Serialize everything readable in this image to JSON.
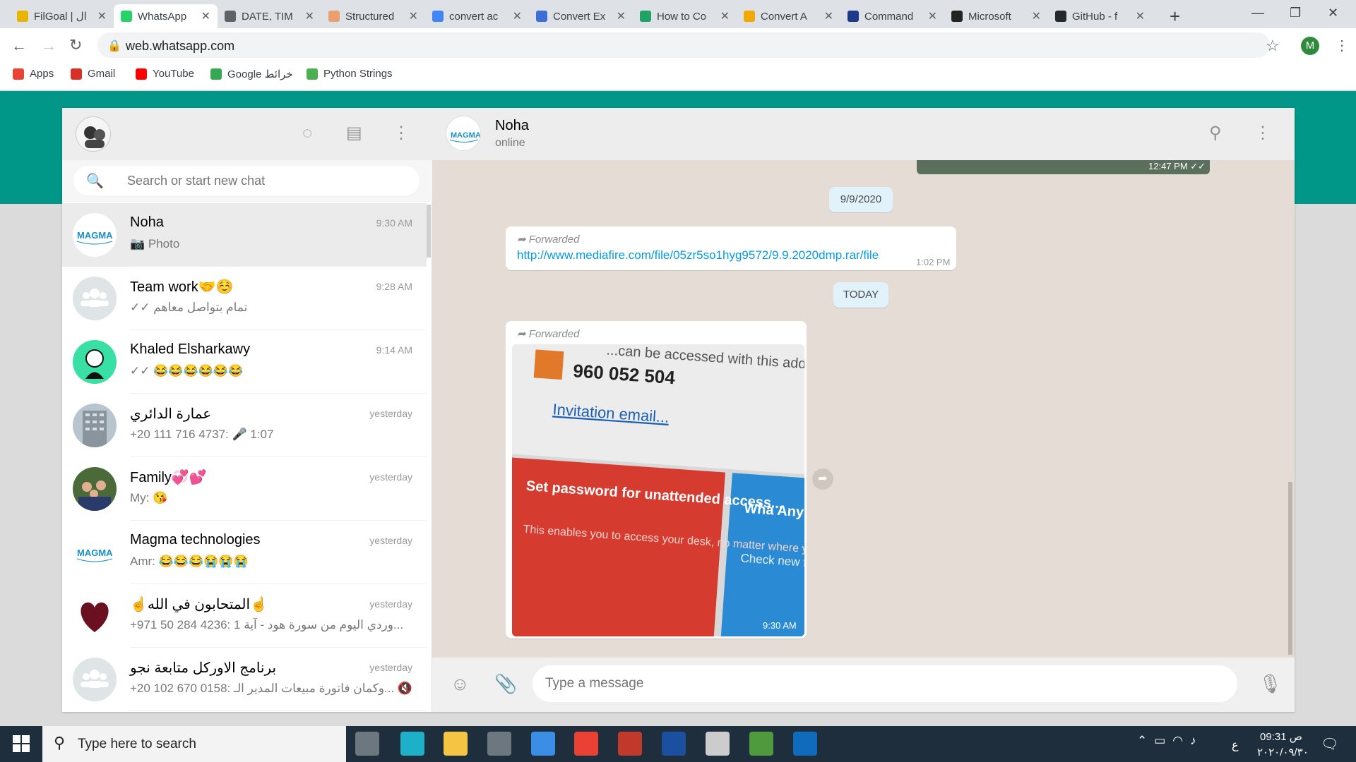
{
  "browser": {
    "tabs": [
      {
        "title": "FilGoal | ال",
        "color": "#e8b400"
      },
      {
        "title": "WhatsApp",
        "color": "#25d366"
      },
      {
        "title": "DATE, TIM",
        "color": "#5f6368"
      },
      {
        "title": "Structured",
        "color": "#e9a06e"
      },
      {
        "title": "convert ac",
        "color": "#4285f4"
      },
      {
        "title": "Convert Ex",
        "color": "#3b6fd6"
      },
      {
        "title": "How to Co",
        "color": "#21a366"
      },
      {
        "title": "Convert A",
        "color": "#f2a900"
      },
      {
        "title": "Command",
        "color": "#1e3a8a"
      },
      {
        "title": "Microsoft",
        "color": "#222222"
      },
      {
        "title": "GitHub - f",
        "color": "#24292e"
      }
    ],
    "close_glyph": "✕",
    "new_tab_glyph": "+",
    "url": "web.whatsapp.com",
    "profile_initial": "M",
    "bookmarks": [
      {
        "label": "Apps",
        "color": "#ea4335"
      },
      {
        "label": "Gmail",
        "color": "#d93025"
      },
      {
        "label": "YouTube",
        "color": "#ff0000"
      },
      {
        "label": "Google خرائط",
        "color": "#34a853"
      },
      {
        "label": "Python Strings",
        "color": "#4caf50"
      }
    ]
  },
  "sidebar": {
    "search_placeholder": "Search or start new chat",
    "chats": [
      {
        "name": "Noha",
        "time": "9:30 AM",
        "last": "📷 Photo",
        "avatar": "magma",
        "active": true
      },
      {
        "name": "Team work🤝☺️",
        "time": "9:28 AM",
        "last": "✓✓ تمام بتواصل معاهم",
        "avatar": "group"
      },
      {
        "name": "Khaled Elsharkawy",
        "time": "9:14 AM",
        "last": "✓✓ 😂😂😂😂😂😂",
        "avatar": "person"
      },
      {
        "name": "عمارة الدائري",
        "time": "yesterday",
        "last": "+20 111 716 4737: 🎤 1:07",
        "avatar": "building"
      },
      {
        "name": "Family💞💕",
        "time": "yesterday",
        "last": "My: 😘",
        "avatar": "family"
      },
      {
        "name": "Magma technologies",
        "time": "yesterday",
        "last": "Amr: 😂😂😂😭😭😭",
        "avatar": "magma"
      },
      {
        "name": "☝️المتحابون في الله☝️",
        "time": "yesterday",
        "last": "+971 50 284 4236: وردي اليوم من سورة هود - آية 1...",
        "avatar": "heart"
      },
      {
        "name": "برنامج الاوركل متابعة نجو",
        "time": "yesterday",
        "last": "+20 102 670 0158: وكمان فاتورة مبيعات المدير الـ... 🔇",
        "avatar": "group"
      }
    ]
  },
  "conversation": {
    "contact_name": "Noha",
    "contact_status": "online",
    "top_image_time": "12:47 PM ✓✓",
    "date_pill": "9/9/2020",
    "today_pill": "TODAY",
    "msg1_forwarded": "➦ Forwarded",
    "msg1_link": "http://www.mediafire.com/file/05zr5so1hyg9572/9.9.2020dmp.rar/file",
    "msg1_time": "1:02 PM",
    "msg2_forwarded": "➦ Forwarded",
    "msg2_time": "9:30 AM",
    "image_text": {
      "header": "...can be accessed with this add",
      "id_number": "960 052 504",
      "invitation": "Invitation email...",
      "red_title": "Set password for unattended access...",
      "red_body": "This enables you to access your desk, no matter where you are.",
      "blue_title": "Wha AnyD",
      "blue_body": "Check new fea"
    },
    "input_placeholder": "Type a message"
  },
  "taskbar": {
    "search_text": "Type here to search",
    "time": "09:31 ص",
    "date": "٢٠٢٠/٠٩/٣٠",
    "lang": "ع",
    "apps": [
      {
        "name": "task-view",
        "color": "#ffffff"
      },
      {
        "name": "edge",
        "color": "#1fb0c9"
      },
      {
        "name": "file-explorer",
        "color": "#f4c542"
      },
      {
        "name": "store",
        "color": "#ffffff"
      },
      {
        "name": "mail",
        "color": "#3b8ee5"
      },
      {
        "name": "chrome",
        "color": "#e94235"
      },
      {
        "name": "access",
        "color": "#c0392b"
      },
      {
        "name": "flag-app",
        "color": "#1b4fa0"
      },
      {
        "name": "monitor-app",
        "color": "#cccccc"
      },
      {
        "name": "turtle-app",
        "color": "#4f9a3c"
      },
      {
        "name": "outlook",
        "color": "#0f6cbd"
      }
    ]
  },
  "colors": {
    "wa_teal": "#009688",
    "link_blue": "#039be5",
    "chat_bg": "#e5ddd5"
  }
}
